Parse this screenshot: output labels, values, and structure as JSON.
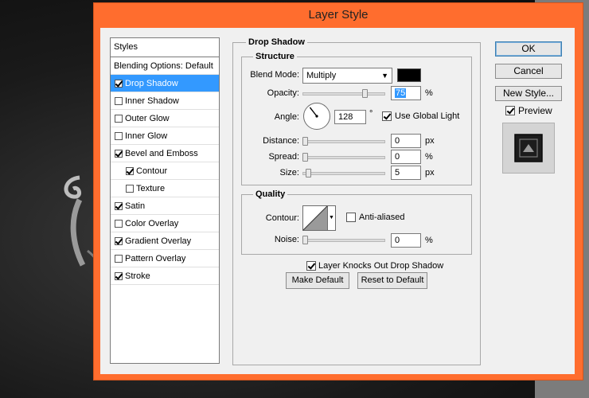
{
  "window": {
    "title": "Layer Style",
    "close_glyph": "✕"
  },
  "styles_panel": {
    "header": "Styles",
    "blending_options": "Blending Options: Default",
    "items": [
      {
        "label": "Drop Shadow",
        "checked": true,
        "selected": true
      },
      {
        "label": "Inner Shadow",
        "checked": false
      },
      {
        "label": "Outer Glow",
        "checked": false
      },
      {
        "label": "Inner Glow",
        "checked": false
      },
      {
        "label": "Bevel and Emboss",
        "checked": true
      },
      {
        "label": "Contour",
        "checked": true,
        "sub": true
      },
      {
        "label": "Texture",
        "checked": false,
        "sub": true
      },
      {
        "label": "Satin",
        "checked": true
      },
      {
        "label": "Color Overlay",
        "checked": false
      },
      {
        "label": "Gradient Overlay",
        "checked": true
      },
      {
        "label": "Pattern Overlay",
        "checked": false
      },
      {
        "label": "Stroke",
        "checked": true
      }
    ]
  },
  "drop_shadow": {
    "title": "Drop Shadow",
    "structure": {
      "title": "Structure",
      "blend_mode_label": "Blend Mode:",
      "blend_mode_value": "Multiply",
      "shadow_color": "#000000",
      "opacity_label": "Opacity:",
      "opacity_value": "75",
      "opacity_fraction": 0.75,
      "percent": "%",
      "angle_label": "Angle:",
      "angle_value": "128",
      "angle_deg": 128,
      "degree_symbol": "°",
      "use_global_light_label": "Use Global Light",
      "use_global_light": true,
      "distance_label": "Distance:",
      "distance_value": "0",
      "px": "px",
      "spread_label": "Spread:",
      "spread_value": "0",
      "size_label": "Size:",
      "size_value": "5"
    },
    "quality": {
      "title": "Quality",
      "contour_label": "Contour:",
      "anti_aliased_label": "Anti-aliased",
      "anti_aliased": false,
      "noise_label": "Noise:",
      "noise_value": "0"
    },
    "knocks_out_label": "Layer Knocks Out Drop Shadow",
    "knocks_out": true,
    "make_default_label": "Make Default",
    "reset_default_label": "Reset to Default"
  },
  "actions": {
    "ok_label": "OK",
    "cancel_label": "Cancel",
    "new_style_label": "New Style...",
    "preview_label": "Preview",
    "preview": true
  }
}
